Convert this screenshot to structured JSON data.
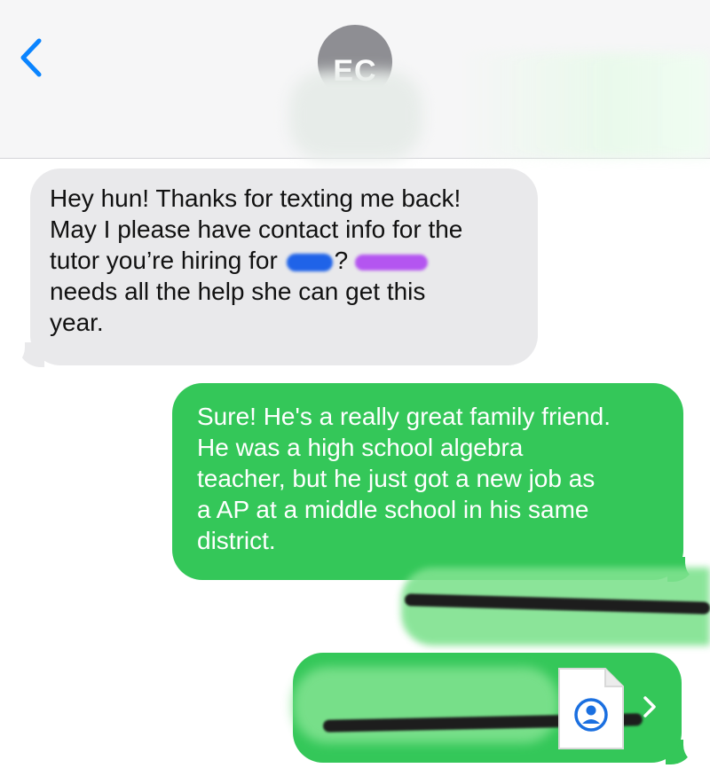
{
  "header": {
    "avatar_initials": "EC",
    "back_icon": "chevron-left-icon"
  },
  "messages": [
    {
      "direction": "incoming",
      "lines": [
        "Hey hun! Thanks for texting me back!",
        "May I please have contact info for the",
        "tutor you’re hiring for",
        "?",
        "needs all the help she can get this",
        "year."
      ]
    },
    {
      "direction": "outgoing",
      "lines": [
        "Sure! He's a really great family friend.",
        "He was a high school algebra",
        "teacher, but he just got a new job as",
        "a AP at a middle school in his same",
        "district."
      ]
    }
  ],
  "contact_card": {
    "icon": "contact-card-icon",
    "chevron": "chevron-right-icon"
  },
  "colors": {
    "header_bg": "#f6f6f7",
    "incoming_bubble": "#e9e9eb",
    "outgoing_bubble": "#34c759",
    "accent_blue": "#0a84ff",
    "avatar_gray": "#8e8e93"
  }
}
